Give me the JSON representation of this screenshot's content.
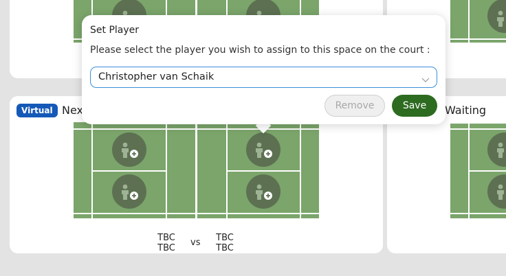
{
  "colors": {
    "accent": "#2d6b21",
    "court": "#7ba56b",
    "badge": "#1559b8",
    "focus": "#3a8fd8"
  },
  "next_card": {
    "badge": "Virtual",
    "title": "Nex",
    "team_left": [
      "TBC",
      "TBC"
    ],
    "vs": "vs",
    "team_right": [
      "TBC",
      "TBC"
    ]
  },
  "waiting_card": {
    "title": "Waiting"
  },
  "modal": {
    "title": "Set Player",
    "prompt": "Please select the player you wish to assign to this space on the court :",
    "selected_player": "Christopher van Schaik",
    "remove_label": "Remove",
    "save_label": "Save"
  },
  "icons": {
    "slot": "add-player-icon",
    "select": "chevron-down-icon"
  }
}
